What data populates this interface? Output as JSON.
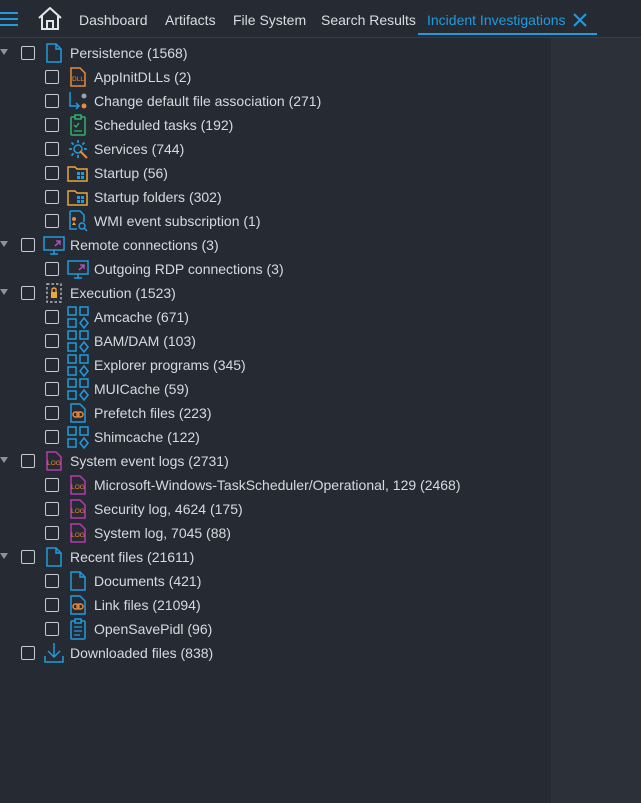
{
  "tabs": [
    {
      "label": "Dashboard",
      "active": false
    },
    {
      "label": "Artifacts",
      "active": false
    },
    {
      "label": "File System",
      "active": false
    },
    {
      "label": "Search Results",
      "active": false
    },
    {
      "label": "Incident Investigations",
      "active": true
    }
  ],
  "colors": {
    "accent": "#1f9bde",
    "background": "#262a33",
    "text": "#d6dae0"
  },
  "tree": [
    {
      "label": "Persistence (1568)",
      "icon": "document-icon",
      "level": 0,
      "expandable": true
    },
    {
      "label": "AppInitDLLs (2)",
      "icon": "dll-file-icon",
      "level": 1
    },
    {
      "label": "Change default file association (271)",
      "icon": "file-association-icon",
      "level": 1
    },
    {
      "label": "Scheduled tasks (192)",
      "icon": "scheduled-task-icon",
      "level": 1
    },
    {
      "label": "Services (744)",
      "icon": "services-gear-icon",
      "level": 1
    },
    {
      "label": "Startup (56)",
      "icon": "startup-folder-icon",
      "level": 1
    },
    {
      "label": "Startup folders (302)",
      "icon": "startup-folder-icon",
      "level": 1
    },
    {
      "label": "WMI event subscription (1)",
      "icon": "wmi-subscription-icon",
      "level": 1
    },
    {
      "label": "Remote connections (3)",
      "icon": "monitor-icon",
      "level": 0,
      "expandable": true
    },
    {
      "label": "Outgoing RDP connections (3)",
      "icon": "monitor-icon",
      "level": 1
    },
    {
      "label": "Execution (1523)",
      "icon": "execution-icon",
      "level": 0,
      "expandable": true
    },
    {
      "label": "Amcache (671)",
      "icon": "app-grid-icon",
      "level": 1
    },
    {
      "label": "BAM/DAM (103)",
      "icon": "app-grid-icon",
      "level": 1
    },
    {
      "label": "Explorer programs (345)",
      "icon": "app-grid-icon",
      "level": 1
    },
    {
      "label": "MUICache (59)",
      "icon": "app-grid-icon",
      "level": 1
    },
    {
      "label": "Prefetch files (223)",
      "icon": "link-file-icon",
      "level": 1
    },
    {
      "label": "Shimcache (122)",
      "icon": "app-grid-icon",
      "level": 1
    },
    {
      "label": "System event logs (2731)",
      "icon": "log-file-icon",
      "level": 0,
      "expandable": true
    },
    {
      "label": "Microsoft-Windows-TaskScheduler/Operational, 129 (2468)",
      "icon": "log-file-icon",
      "level": 1
    },
    {
      "label": "Security log, 4624 (175)",
      "icon": "log-file-icon",
      "level": 1
    },
    {
      "label": "System log, 7045 (88)",
      "icon": "log-file-icon",
      "level": 1
    },
    {
      "label": "Recent files (21611)",
      "icon": "document-icon",
      "level": 0,
      "expandable": true
    },
    {
      "label": "Documents (421)",
      "icon": "document-icon",
      "level": 1
    },
    {
      "label": "Link files (21094)",
      "icon": "link-file-icon",
      "level": 1
    },
    {
      "label": "OpenSavePidl (96)",
      "icon": "clipboard-icon",
      "level": 1
    },
    {
      "label": "Downloaded files (838)",
      "icon": "download-icon",
      "level": 0,
      "expandable": false
    }
  ]
}
